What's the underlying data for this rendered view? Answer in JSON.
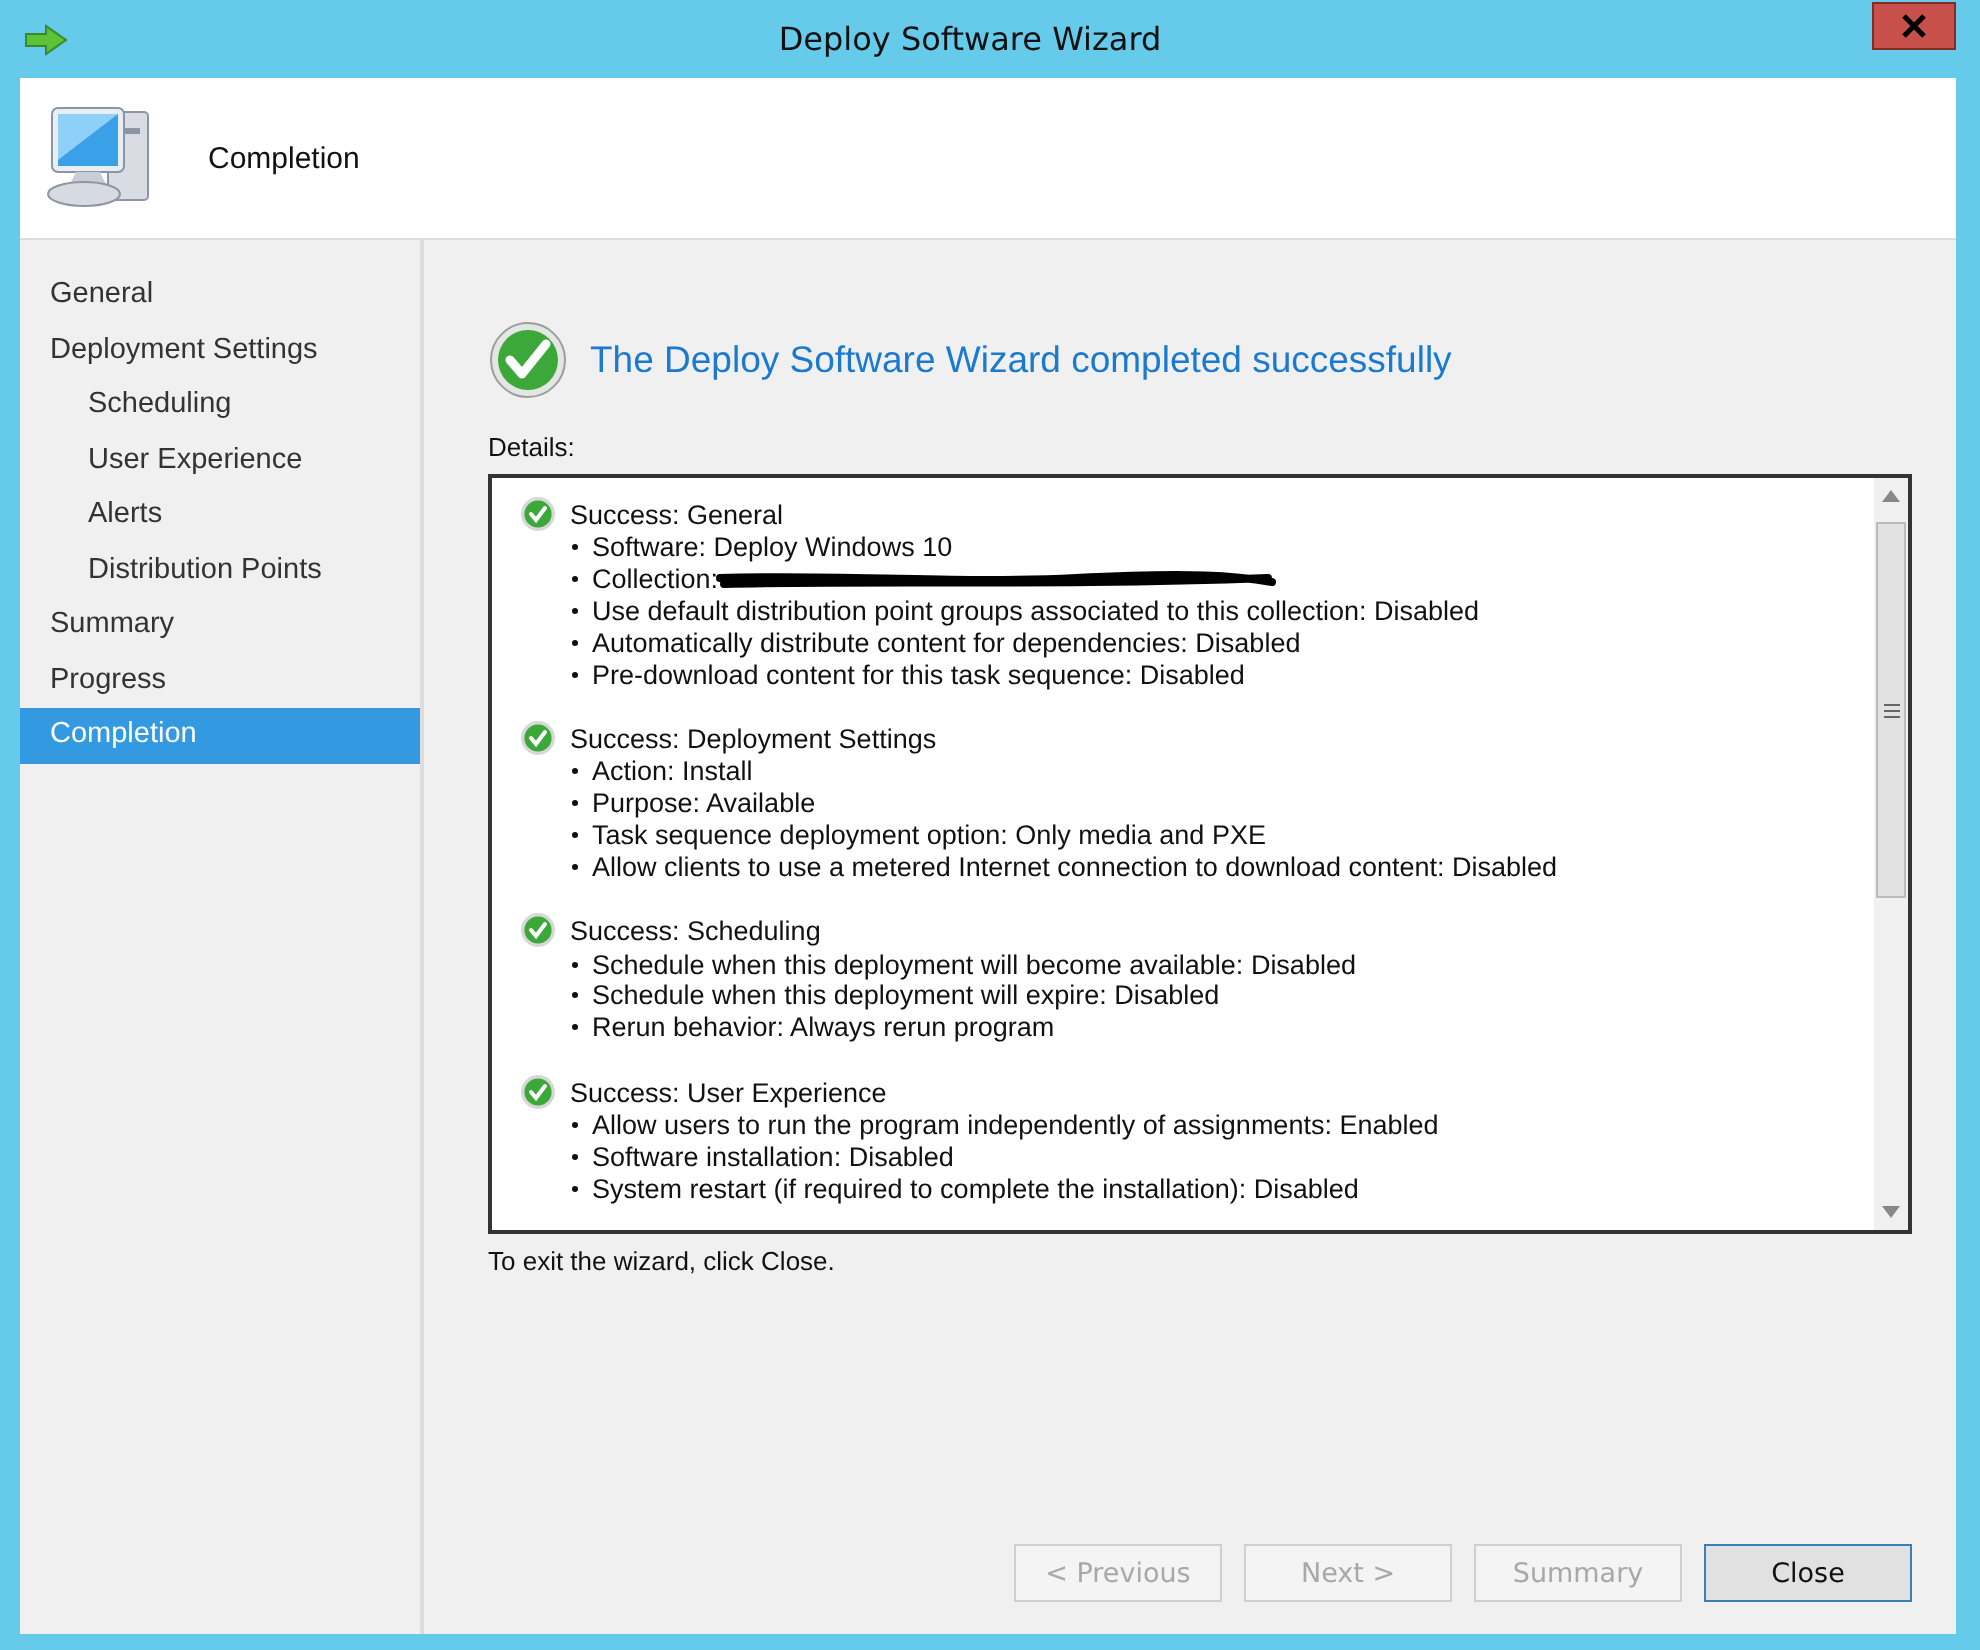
{
  "window": {
    "title": "Deploy Software Wizard"
  },
  "header": {
    "title": "Completion"
  },
  "sidebar": {
    "items": [
      {
        "label": "General",
        "selected": false
      },
      {
        "label": "Deployment Settings",
        "selected": false,
        "children": [
          {
            "label": "Scheduling",
            "selected": false
          },
          {
            "label": "User Experience",
            "selected": false
          },
          {
            "label": "Alerts",
            "selected": false
          },
          {
            "label": "Distribution Points",
            "selected": false
          }
        ]
      },
      {
        "label": "Summary",
        "selected": false
      },
      {
        "label": "Progress",
        "selected": false
      },
      {
        "label": "Completion",
        "selected": true
      }
    ]
  },
  "result": {
    "message": "The Deploy Software Wizard completed successfully"
  },
  "details": {
    "label": "Details:",
    "sections": [
      {
        "title": "Success: General",
        "items": [
          {
            "text": "Software: Deploy Windows 10",
            "redacted": false
          },
          {
            "text": "Collection:",
            "redacted": true
          },
          {
            "text": "Use default distribution point groups associated to this collection: Disabled",
            "redacted": false
          },
          {
            "text": "Automatically distribute content for dependencies: Disabled",
            "redacted": false
          },
          {
            "text": "Pre-download content for this task sequence: Disabled",
            "redacted": false
          }
        ]
      },
      {
        "title": "Success: Deployment Settings",
        "items": [
          {
            "text": "Action: Install",
            "redacted": false
          },
          {
            "text": "Purpose: Available",
            "redacted": false
          },
          {
            "text": "Task sequence deployment option: Only media and PXE",
            "redacted": false
          },
          {
            "text": "Allow clients to use a metered Internet connection to download content: Disabled",
            "redacted": false
          }
        ]
      },
      {
        "title": "Success: Scheduling",
        "items": [
          {
            "text": "Schedule when this deployment will become available: Disabled",
            "redacted": false
          },
          {
            "text": "Schedule when this deployment will expire: Disabled",
            "redacted": false
          },
          {
            "text": "Rerun behavior: Always rerun program",
            "redacted": false
          }
        ]
      },
      {
        "title": "Success: User Experience",
        "items": [
          {
            "text": "Allow users to run the program independently of assignments: Enabled",
            "redacted": false
          },
          {
            "text": "Software installation: Disabled",
            "redacted": false
          },
          {
            "text": "System restart (if required to complete the installation): Disabled",
            "redacted": false
          }
        ]
      }
    ]
  },
  "exit_hint": "To exit the wizard, click Close.",
  "buttons": [
    {
      "label": "< Previous",
      "disabled": true,
      "default": false
    },
    {
      "label": "Next >",
      "disabled": true,
      "default": false
    },
    {
      "label": "Summary",
      "disabled": true,
      "default": false
    },
    {
      "label": "Close",
      "disabled": false,
      "default": true
    }
  ]
}
